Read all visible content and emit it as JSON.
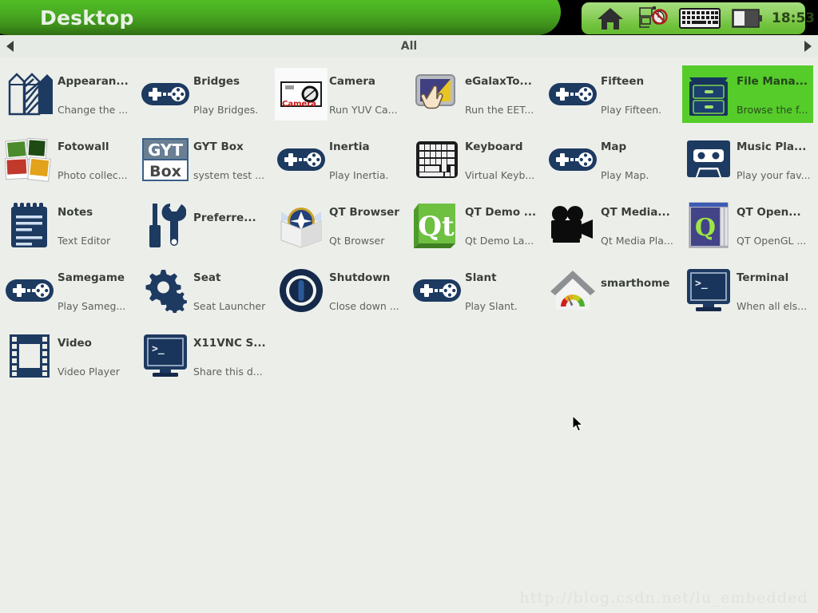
{
  "titlebar": {
    "title": "Desktop",
    "tray": {
      "icons": [
        "home-icon",
        "network-disabled-icon",
        "keyboard-icon",
        "battery-icon"
      ],
      "clock": "18:53"
    }
  },
  "navbar": {
    "label": "All",
    "left_arrow": "prev-page-arrow",
    "right_arrow": "next-page-arrow"
  },
  "apps": [
    {
      "title": "Appearan...",
      "desc": "Change the ...",
      "icon": "pencils-icon",
      "selected": false
    },
    {
      "title": "Bridges",
      "desc": "Play Bridges.",
      "icon": "gamepad-icon",
      "selected": false
    },
    {
      "title": "Camera",
      "desc": "Run YUV Ca...",
      "icon": "camera-icon",
      "selected": false
    },
    {
      "title": "eGalaxTo...",
      "desc": "Run the EET...",
      "icon": "touch-hand-icon",
      "selected": false
    },
    {
      "title": "Fifteen",
      "desc": "Play Fifteen.",
      "icon": "gamepad-icon",
      "selected": false
    },
    {
      "title": "File Mana...",
      "desc": "Browse the f...",
      "icon": "file-cabinet-icon",
      "selected": true
    },
    {
      "title": "Fotowall",
      "desc": "Photo collec...",
      "icon": "photos-icon",
      "selected": false
    },
    {
      "title": "GYT Box",
      "desc": "system test ...",
      "icon": "gytbox-icon",
      "selected": false
    },
    {
      "title": "Inertia",
      "desc": "Play Inertia.",
      "icon": "gamepad-icon",
      "selected": false
    },
    {
      "title": "Keyboard",
      "desc": "Virtual Keyb...",
      "icon": "keyboard-icon",
      "selected": false
    },
    {
      "title": "Map",
      "desc": "Play Map.",
      "icon": "gamepad-icon",
      "selected": false
    },
    {
      "title": "Music Pla...",
      "desc": "Play your fav...",
      "icon": "cassette-icon",
      "selected": false
    },
    {
      "title": "Notes",
      "desc": "Text Editor",
      "icon": "notepad-icon",
      "selected": false
    },
    {
      "title": "Preferre...",
      "desc": "",
      "icon": "tools-icon",
      "selected": false
    },
    {
      "title": "QT Browser",
      "desc": "Qt Browser",
      "icon": "compass-box-icon",
      "selected": false
    },
    {
      "title": "QT Demo ...",
      "desc": "Qt Demo La...",
      "icon": "qt-logo-icon",
      "selected": false
    },
    {
      "title": "QT Media...",
      "desc": "Qt Media Pla...",
      "icon": "movie-camera-icon",
      "selected": false
    },
    {
      "title": "QT Open...",
      "desc": "QT OpenGL ...",
      "icon": "qt-window-icon",
      "selected": false
    },
    {
      "title": "Samegame",
      "desc": "Play Sameg...",
      "icon": "gamepad-icon",
      "selected": false
    },
    {
      "title": "Seat",
      "desc": "Seat Launcher",
      "icon": "gears-icon",
      "selected": false
    },
    {
      "title": "Shutdown",
      "desc": "Close down ...",
      "icon": "power-icon",
      "selected": false
    },
    {
      "title": "Slant",
      "desc": "Play Slant.",
      "icon": "gamepad-icon",
      "selected": false
    },
    {
      "title": "smarthome",
      "desc": "",
      "icon": "smarthome-icon",
      "selected": false
    },
    {
      "title": "Terminal",
      "desc": "When all els...",
      "icon": "terminal-icon",
      "selected": false
    },
    {
      "title": "Video",
      "desc": "Video Player",
      "icon": "filmstrip-icon",
      "selected": false
    },
    {
      "title": "X11VNC S...",
      "desc": "Share this d...",
      "icon": "terminal-icon",
      "selected": false
    }
  ],
  "watermark": "http://blog.csdn.net/lu_embedded",
  "colors": {
    "titlebar_green": "#4fb825",
    "selection_green": "#55cc2a",
    "desktop_bg": "#eceeea",
    "icon_navy": "#1d3a61"
  }
}
